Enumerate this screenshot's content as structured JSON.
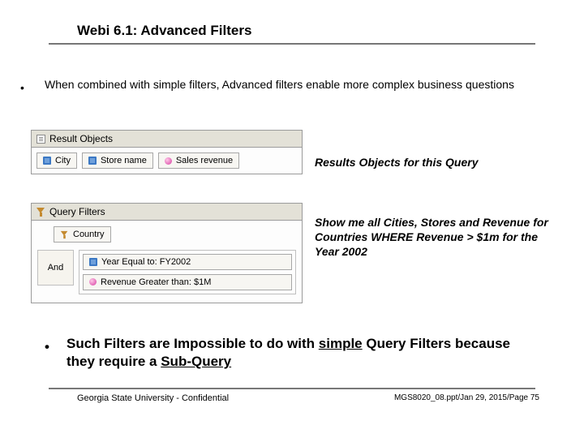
{
  "title": "Webi 6.1: Advanced Filters",
  "bullet1": "When combined with simple filters, Advanced filters enable more complex business questions",
  "result_objects": {
    "header": "Result Objects",
    "items": [
      {
        "label": "City",
        "type": "dimension"
      },
      {
        "label": "Store name",
        "type": "dimension"
      },
      {
        "label": "Sales revenue",
        "type": "measure"
      }
    ],
    "caption": "Results Objects for this Query"
  },
  "query_filters": {
    "header": "Query Filters",
    "country": {
      "label": "Country"
    },
    "and_label": "And",
    "conditions": [
      {
        "label": "Year Equal to: FY2002",
        "type": "dimension"
      },
      {
        "label": "Revenue Greater than: $1M",
        "type": "measure"
      }
    ],
    "caption": "Show me all Cities, Stores and Revenue for Countries WHERE Revenue > $1m for the Year 2002"
  },
  "bullet2_pre": "Such Filters are Impossible to do with ",
  "bullet2_u1": "simple",
  "bullet2_mid": " Query Filters because they require a ",
  "bullet2_u2": "Sub-Query",
  "footer_left": "Georgia State University - Confidential",
  "footer_right": "MGS8020_08.ppt/Jan 29, 2015/Page 75"
}
